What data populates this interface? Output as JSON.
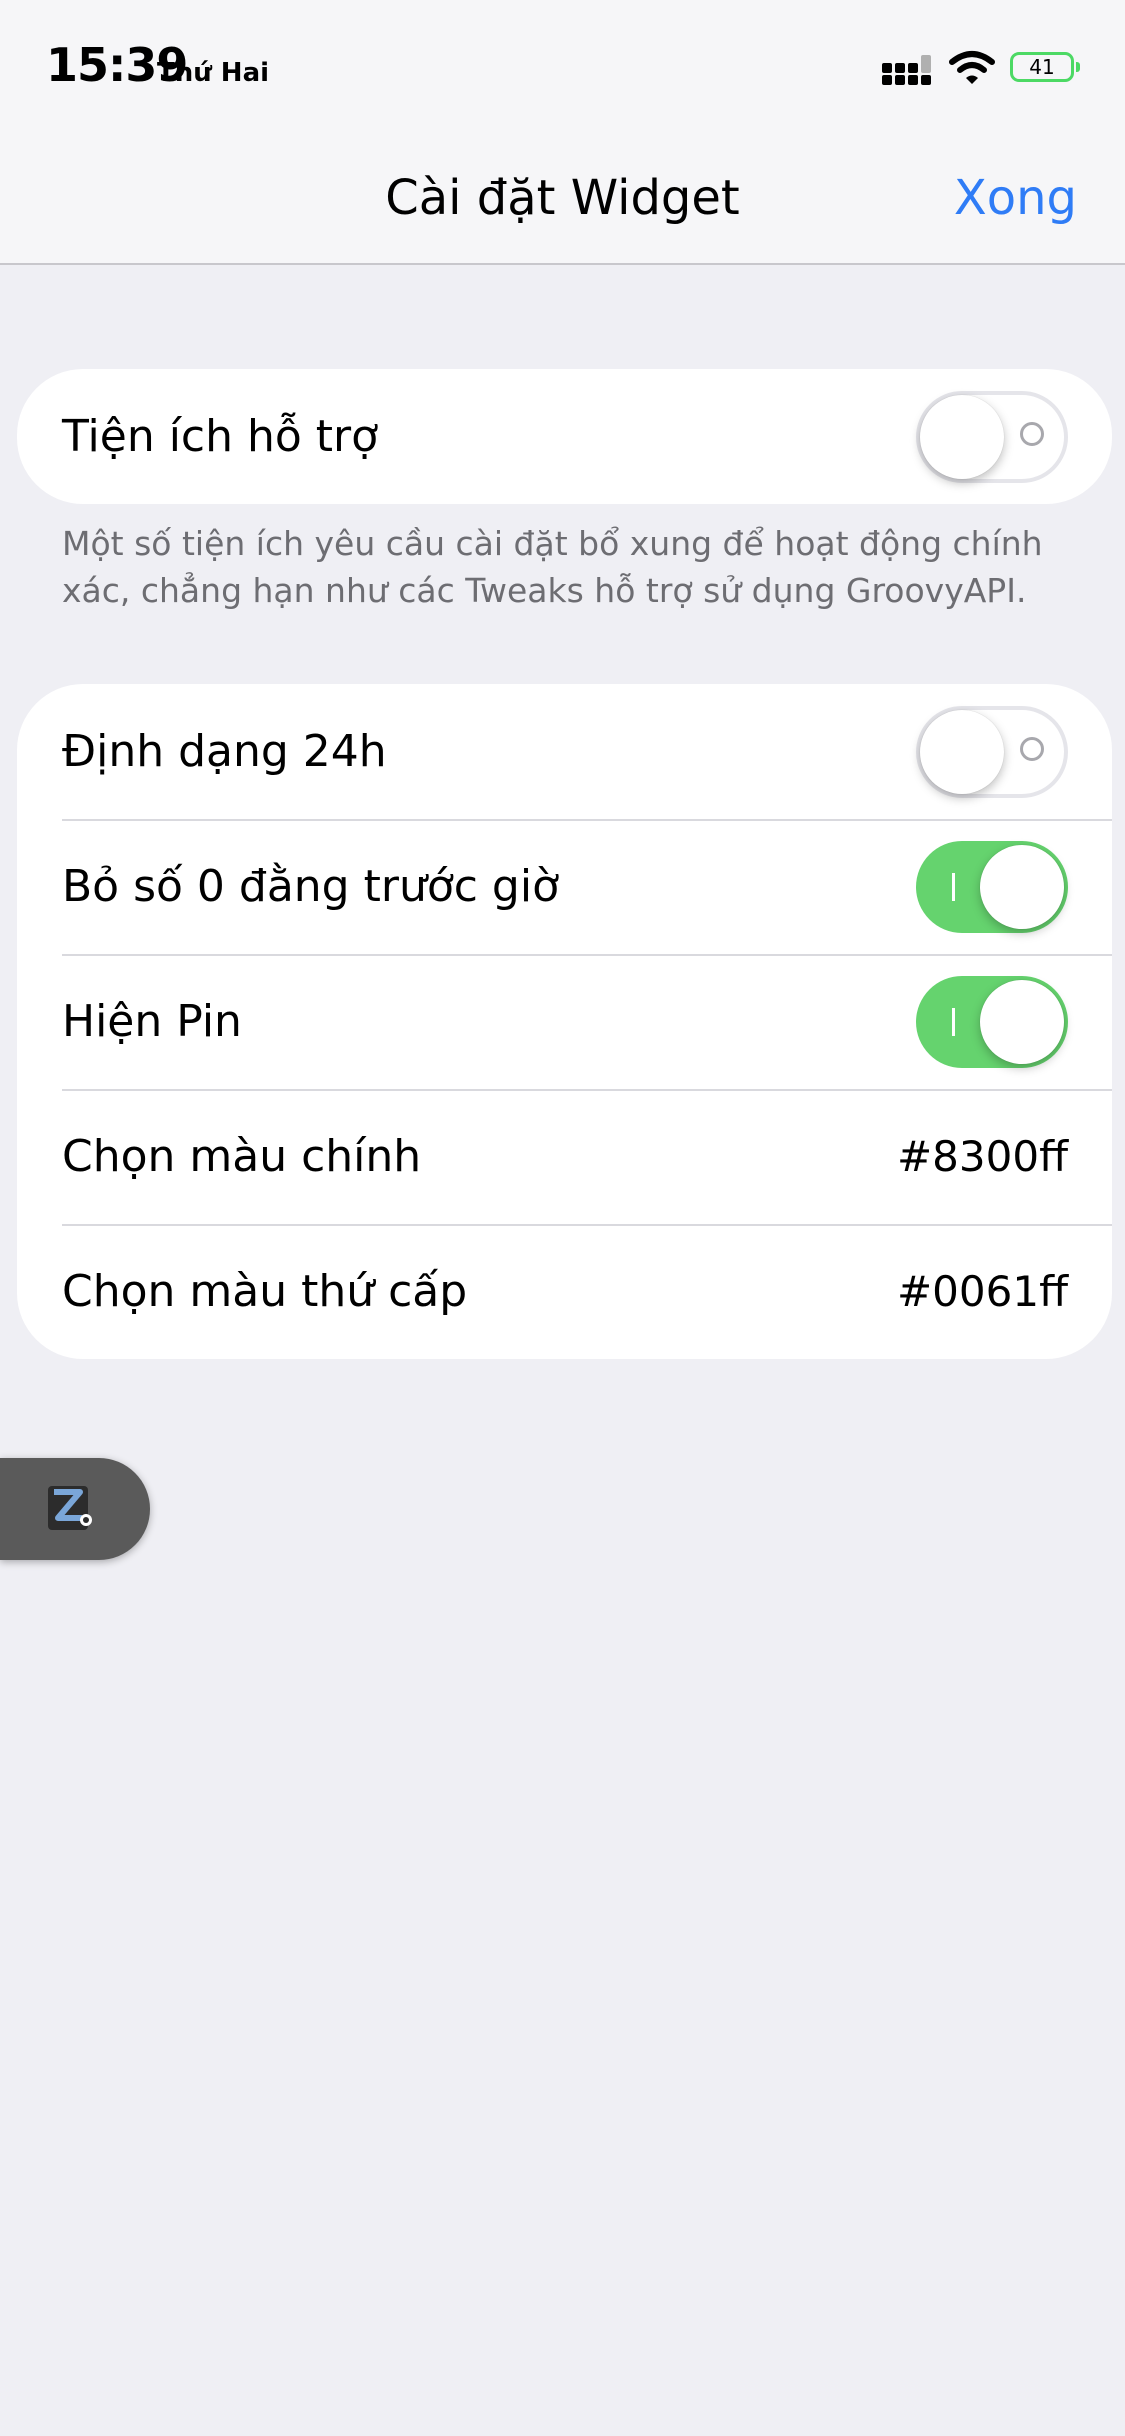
{
  "status_bar": {
    "time": "15:39",
    "day": "Thứ Hai",
    "battery": "41",
    "battery_color": "#4cd964",
    "icons": [
      "cellular-signal-icon",
      "wifi-icon",
      "battery-icon"
    ]
  },
  "nav": {
    "title": "Cài đặt Widget",
    "done_label": "Xong",
    "accent": "#2f7cf6"
  },
  "group1": {
    "rows": [
      {
        "label": "Tiện ích hỗ trợ",
        "toggle": false
      }
    ],
    "footer": "Một số tiện ích yêu cầu cài đặt bổ xung để hoạt động chính xác, chẳng hạn như các Tweaks hỗ trợ sử dụng GroovyAPI."
  },
  "group2": {
    "rows": [
      {
        "label": "Định dạng 24h",
        "toggle": false
      },
      {
        "label": "Bỏ số 0 đằng trước giờ",
        "toggle": true
      },
      {
        "label": "Hiện Pin",
        "toggle": true
      },
      {
        "label": "Chọn màu chính",
        "value": "#8300ff"
      },
      {
        "label": "Chọn màu thứ cấp",
        "value": "#0061ff"
      }
    ]
  },
  "toggle_on_color": "#65d36e",
  "floating_bubble": {
    "icon": "zalo-app-icon"
  }
}
